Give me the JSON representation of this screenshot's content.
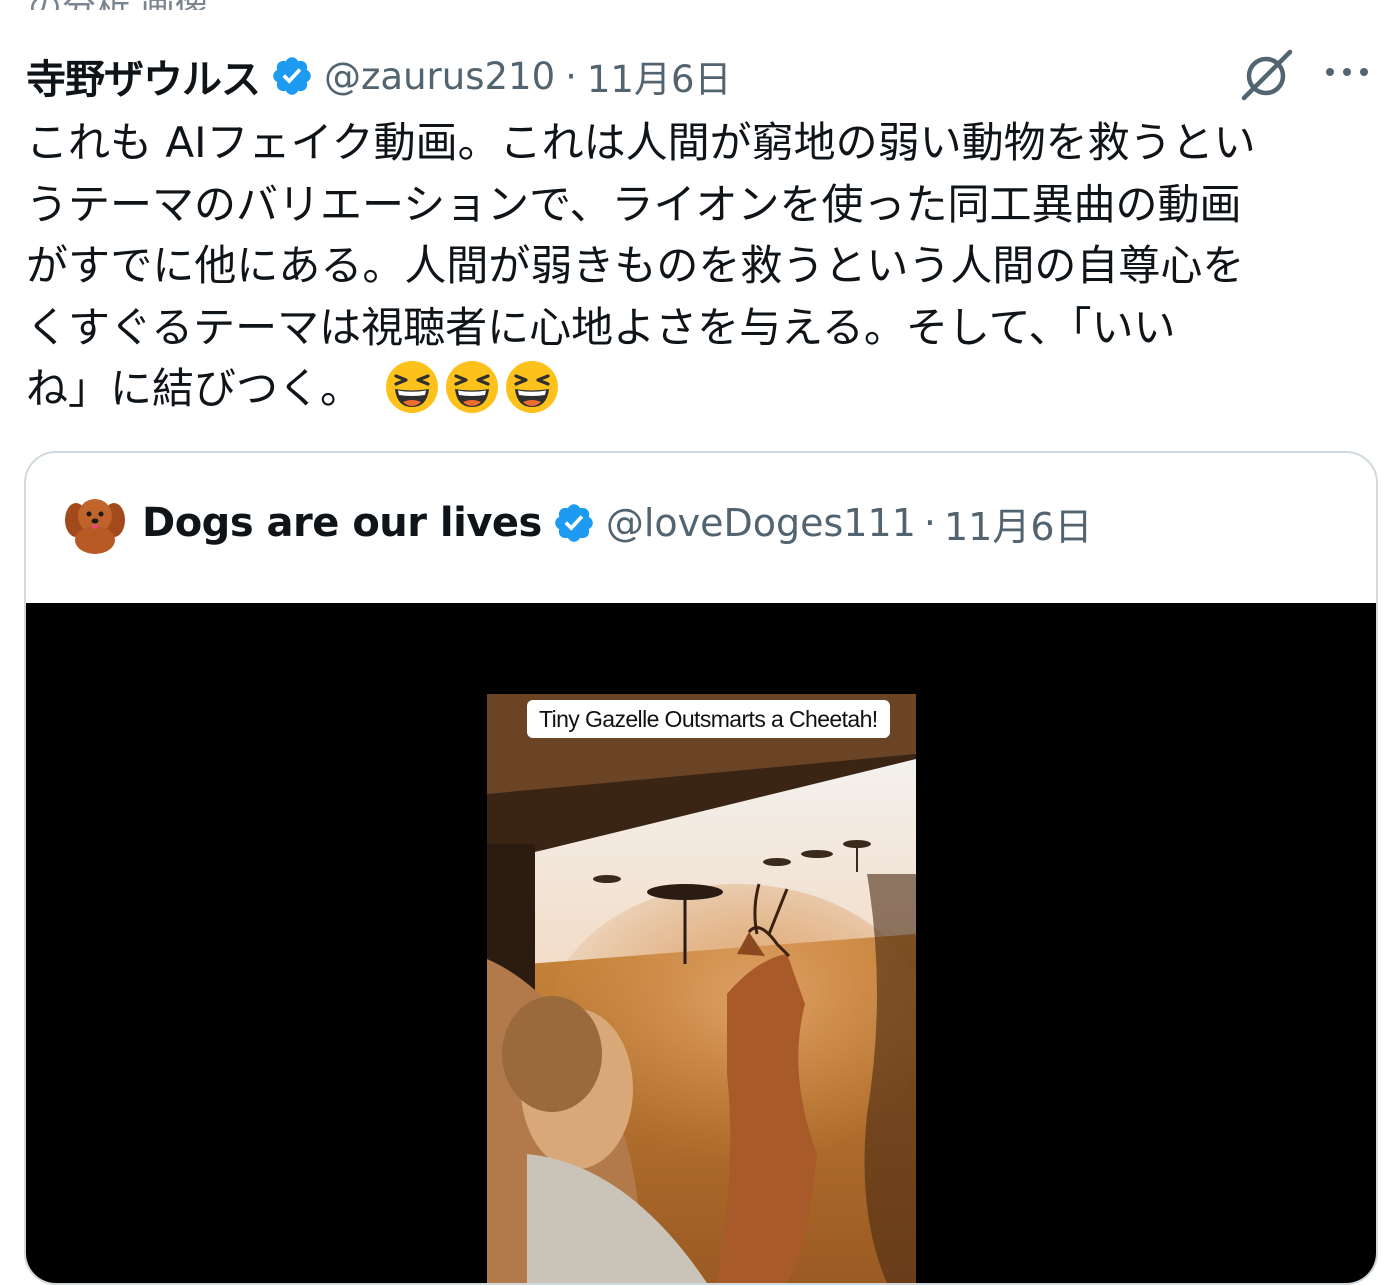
{
  "top_partial_text": "の分析 画像",
  "tweet": {
    "author_name": "寺野ザウルス",
    "handle": "@zaurus210",
    "separator": "·",
    "date": "11月6日",
    "text_lines": [
      "これも AIフェイク動画。これは人間が窮地の弱い動物を救うとい",
      "うテーマのバリエーションで、ライオンを使った同工異曲の動画",
      "がすでに他にある。人間が弱きものを救うという人間の自尊心を",
      "くすぐるテーマは視聴者に心地よさを与える。そして、「いい",
      "ね」に結びつく。"
    ],
    "emojis": [
      "grinning-squinting-face",
      "grinning-squinting-face",
      "grinning-squinting-face"
    ],
    "icons": {
      "grok": "grok-icon",
      "more": "more-icon",
      "verified": "verified-badge-icon"
    },
    "verified_color": "#1d9bf0"
  },
  "quote": {
    "author_name": "Dogs are our lives",
    "handle": "@loveDoges111",
    "separator": "·",
    "date": "11月6日",
    "avatar": "dog-avatar",
    "video_caption": "Tiny Gazelle Outsmarts a Cheetah!"
  }
}
